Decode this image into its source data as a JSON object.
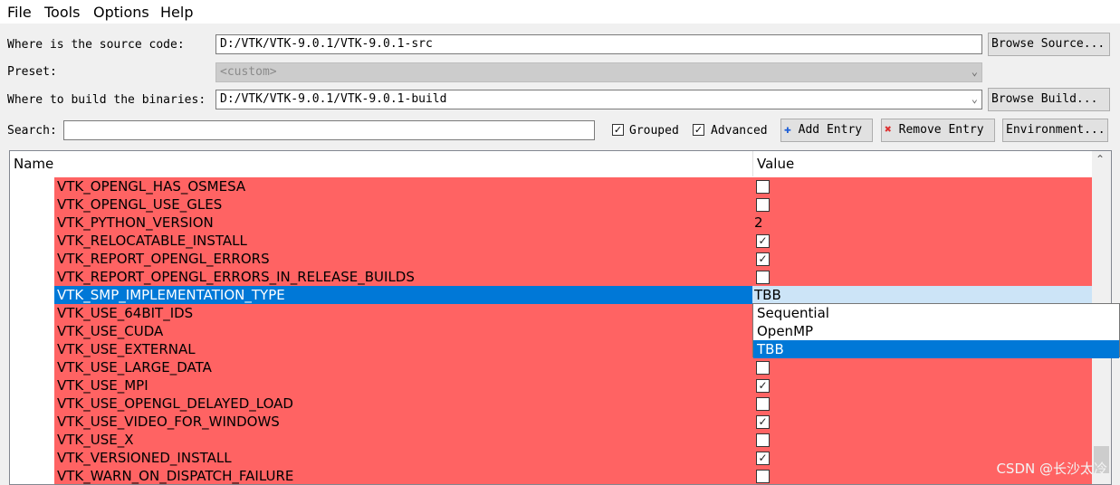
{
  "menu": [
    "File",
    "Tools",
    "Options",
    "Help"
  ],
  "source": {
    "label": "Where is the source code:",
    "value": "D:/VTK/VTK-9.0.1/VTK-9.0.1-src",
    "button": "Browse Source..."
  },
  "preset": {
    "label": "Preset:",
    "value": "<custom>"
  },
  "build": {
    "label": "Where to build the binaries:",
    "value": "D:/VTK/VTK-9.0.1/VTK-9.0.1-build",
    "button": "Browse Build..."
  },
  "search": {
    "label": "Search:",
    "value": ""
  },
  "toolbar": {
    "grouped": "Grouped",
    "grouped_checked": true,
    "advanced": "Advanced",
    "advanced_checked": true,
    "add_entry": "Add Entry",
    "remove_entry": "Remove Entry",
    "environment": "Environment..."
  },
  "table": {
    "columns": [
      "Name",
      "Value"
    ],
    "rows": [
      {
        "name": "VTK_OPENGL_HAS_OSMESA",
        "type": "bool",
        "checked": false
      },
      {
        "name": "VTK_OPENGL_USE_GLES",
        "type": "bool",
        "checked": false
      },
      {
        "name": "VTK_PYTHON_VERSION",
        "type": "text",
        "value": "2"
      },
      {
        "name": "VTK_RELOCATABLE_INSTALL",
        "type": "bool",
        "checked": true
      },
      {
        "name": "VTK_REPORT_OPENGL_ERRORS",
        "type": "bool",
        "checked": true
      },
      {
        "name": "VTK_REPORT_OPENGL_ERRORS_IN_RELEASE_BUILDS",
        "type": "bool",
        "checked": false
      },
      {
        "name": "VTK_SMP_IMPLEMENTATION_TYPE",
        "type": "combo",
        "value": "TBB",
        "selected": true
      },
      {
        "name": "VTK_USE_64BIT_IDS",
        "type": "bool",
        "checked": false
      },
      {
        "name": "VTK_USE_CUDA",
        "type": "bool",
        "checked": false
      },
      {
        "name": "VTK_USE_EXTERNAL",
        "type": "bool",
        "checked": false
      },
      {
        "name": "VTK_USE_LARGE_DATA",
        "type": "bool",
        "checked": false
      },
      {
        "name": "VTK_USE_MPI",
        "type": "bool",
        "checked": true
      },
      {
        "name": "VTK_USE_OPENGL_DELAYED_LOAD",
        "type": "bool",
        "checked": false
      },
      {
        "name": "VTK_USE_VIDEO_FOR_WINDOWS",
        "type": "bool",
        "checked": true
      },
      {
        "name": "VTK_USE_X",
        "type": "bool",
        "checked": false
      },
      {
        "name": "VTK_VERSIONED_INSTALL",
        "type": "bool",
        "checked": true
      },
      {
        "name": "VTK_WARN_ON_DISPATCH_FAILURE",
        "type": "bool",
        "checked": false
      }
    ]
  },
  "dropdown": {
    "options": [
      "Sequential",
      "OpenMP",
      "TBB"
    ],
    "active": "TBB"
  },
  "watermark": "CSDN @长沙太冷",
  "colors": {
    "row_error": "#ff6363",
    "selection": "#0078d7",
    "value_highlight": "#cce4f7"
  }
}
